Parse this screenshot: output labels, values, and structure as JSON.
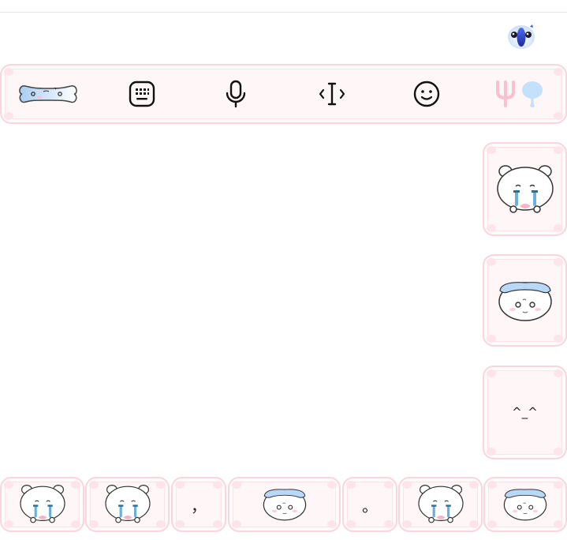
{
  "colors": {
    "cushion_fill": "#fff6f7",
    "cushion_border": "#f8d6dd",
    "accent_blue": "#b9d7f7",
    "accent_pink": "#f9c3d3",
    "icon_stroke": "#111111"
  },
  "top_bar": {
    "assistant_icon": "bird-mascot-icon"
  },
  "toolbar": {
    "items": [
      {
        "icon": "bone-sticker-icon"
      },
      {
        "icon": "keyboard-icon"
      },
      {
        "icon": "microphone-icon"
      },
      {
        "icon": "text-cursor-icon"
      },
      {
        "icon": "emoji-icon"
      },
      {
        "icon": "fork-spoon-icon"
      }
    ]
  },
  "side_keys": [
    {
      "icon": "crying-bear-sticker-icon"
    },
    {
      "icon": "blue-hat-bear-sticker-icon"
    },
    {
      "text": "^_^"
    }
  ],
  "bottom_keys": [
    {
      "icon": "crying-bear-sticker-icon"
    },
    {
      "icon": "crying-bear-sticker-icon"
    },
    {
      "text": "，"
    },
    {
      "icon": "blue-hat-bear-sticker-icon"
    },
    {
      "text": "。"
    },
    {
      "icon": "crying-bear-sticker-icon"
    },
    {
      "icon": "blue-hat-bear-sticker-icon"
    }
  ]
}
